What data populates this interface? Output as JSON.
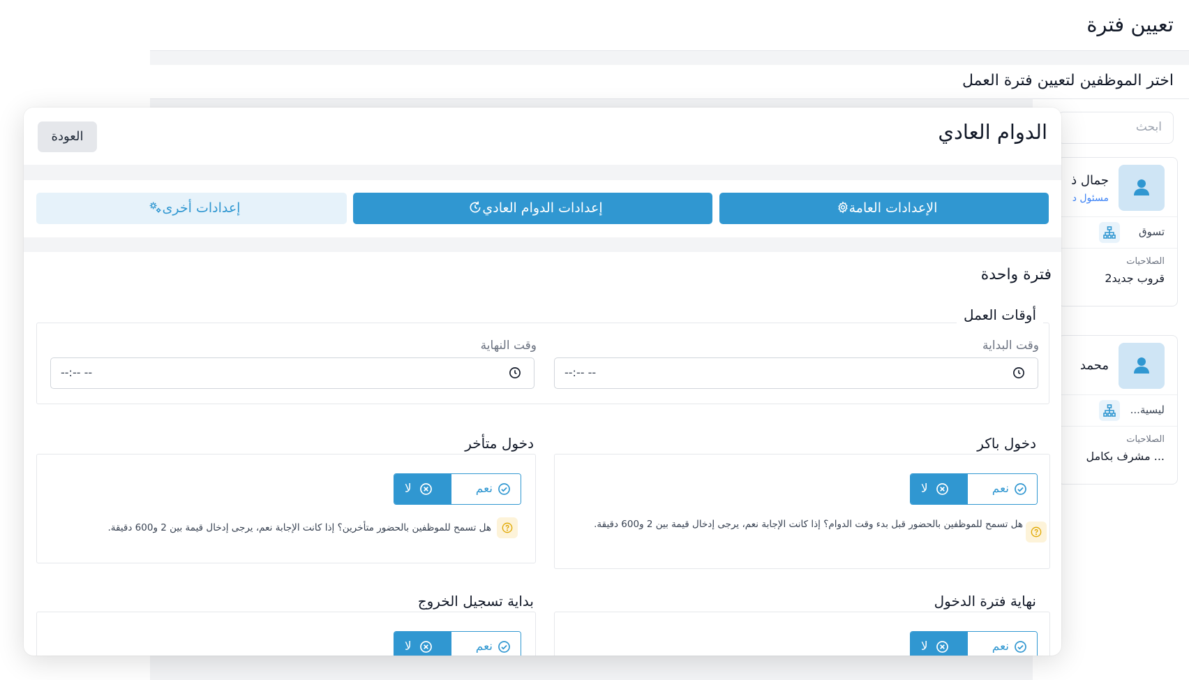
{
  "background": {
    "page_title": "تعيين فترة",
    "subtitle": "اختر الموظفين لتعيين فترة العمل",
    "search_placeholder": "ابحث",
    "employees": [
      {
        "name": "جمال ذ",
        "role": "مسئول د",
        "department": "تسوق",
        "permissions_label": "الصلاحيات",
        "permissions": "قروب جديد2"
      },
      {
        "name": "محمد",
        "role": "",
        "department": "...ليسية",
        "permissions_label": "الصلاحيات",
        "permissions": "مشرف بكامل ..."
      }
    ]
  },
  "modal": {
    "title": "الدوام العادي",
    "back_label": "العودة",
    "tabs": [
      {
        "label": "الإعدادات العامة",
        "icon": "gear-icon"
      },
      {
        "label": "إعدادات الدوام العادي",
        "icon": "rotate-clock-icon"
      },
      {
        "label": "إعدادات أخرى",
        "icon": "gears-icon"
      }
    ],
    "section_title": "فترة واحدة",
    "work_times": {
      "legend": "أوقات العمل",
      "start_label": "وقت البداية",
      "start_value": "--:-- --",
      "end_label": "وقت النهاية",
      "end_value": "--:-- --"
    },
    "early_entry": {
      "legend": "دخول باكر",
      "yes": "نعم",
      "no": "لا",
      "help": "هل تسمح للموظفين بالحضور قبل بدء وقت الدوام؟ إذا كانت الإجابة نعم، يرجى إدخال قيمة بين 2 و600 دقيقة."
    },
    "late_entry": {
      "legend": "دخول متأخر",
      "yes": "نعم",
      "no": "لا",
      "help": "هل تسمح للموظفين بالحضور متأخرين؟ إذا كانت الإجابة نعم، يرجى إدخال قيمة بين 2 و600 دقيقة."
    },
    "entry_end": {
      "legend": "نهاية فترة الدخول",
      "yes": "نعم",
      "no": "لا"
    },
    "checkout_start": {
      "legend": "بداية تسجيل الخروج",
      "yes": "نعم",
      "no": "لا"
    }
  },
  "colors": {
    "accent": "#3097d1",
    "accent_light": "#e6f2fa",
    "help_bg": "#fdf3d9",
    "help_icon": "#e0a800"
  }
}
